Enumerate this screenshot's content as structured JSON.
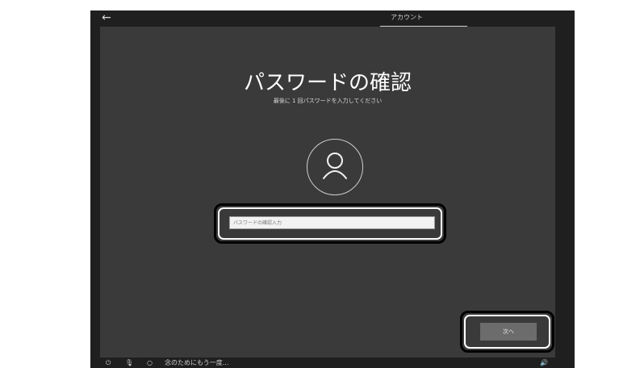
{
  "header": {
    "tab_label": "アカウント"
  },
  "main": {
    "title": "パスワードの確認",
    "subtitle": "最後に 1 回パスワードを入力してください",
    "password_placeholder": "パスワードの確認入力",
    "next_label": "次へ"
  },
  "footer": {
    "hint_text": "念のためにもう一度..."
  },
  "icons": {
    "back": "back-arrow-icon",
    "user": "user-icon",
    "power": "power-icon",
    "mic": "microphone-icon",
    "cortana": "cortana-circle-icon",
    "volume": "volume-icon"
  },
  "colors": {
    "frame": "#1f1f1f",
    "panel": "#3a3a3a",
    "button": "#6c6c6c",
    "highlight": "#000000"
  }
}
